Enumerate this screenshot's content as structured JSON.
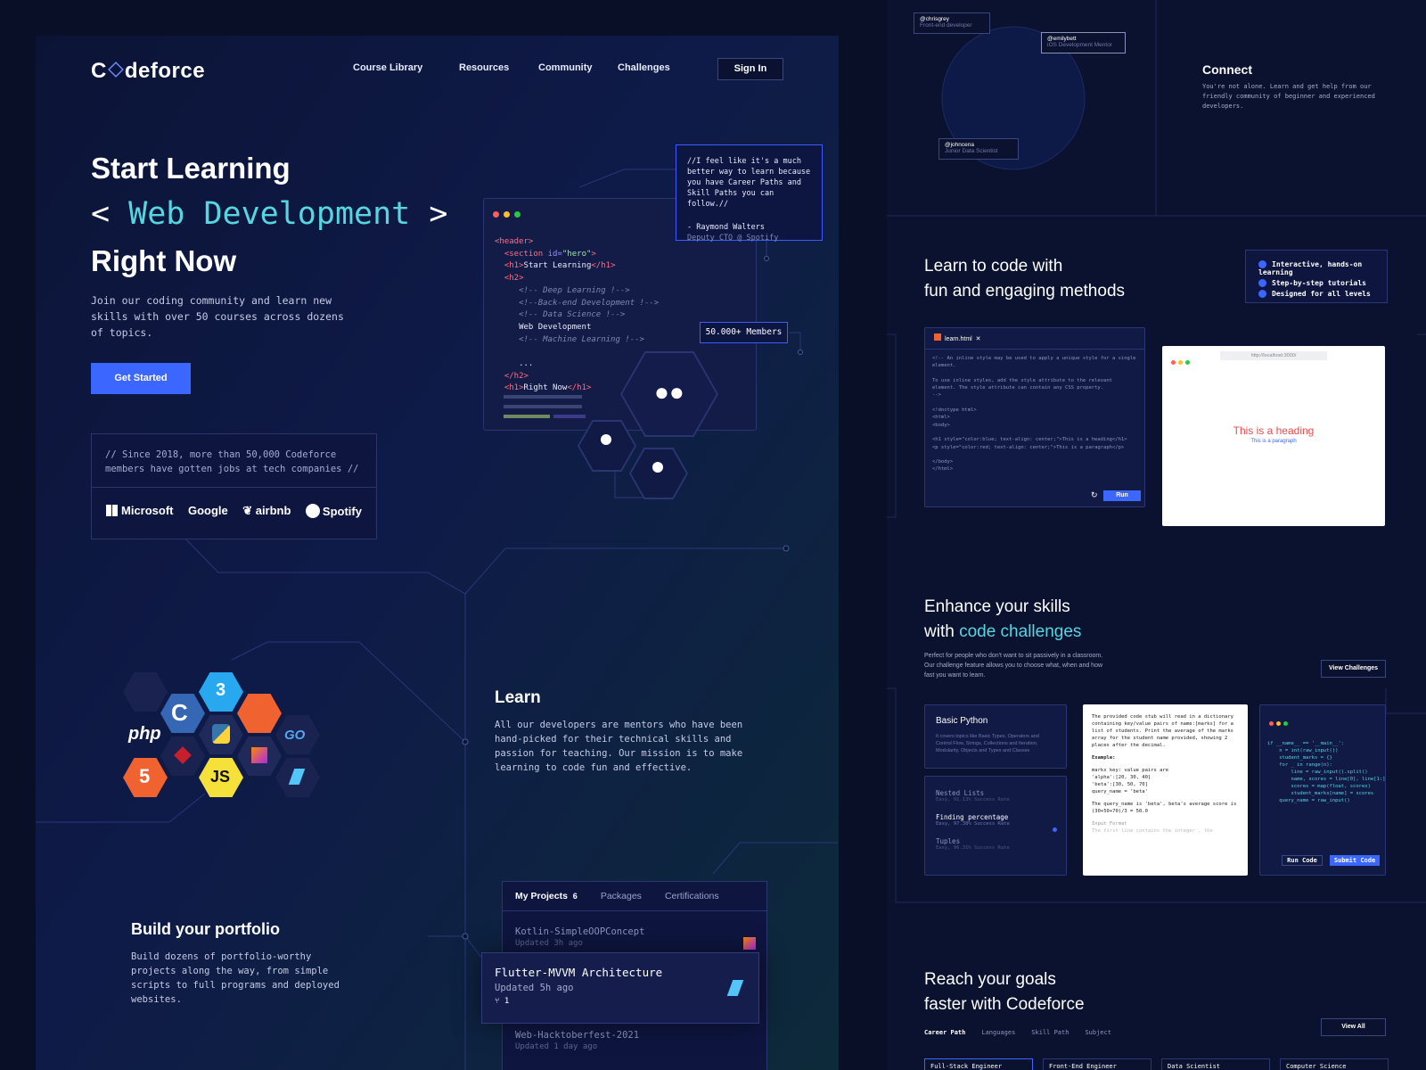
{
  "brand": {
    "name_pre": "C",
    "name_post": "deforce"
  },
  "nav": {
    "items": [
      "Course Library",
      "Resources",
      "Community",
      "Challenges"
    ],
    "signin": "Sign In"
  },
  "hero": {
    "line1": "Start Learning",
    "open": "<",
    "topic": "Web Development",
    "close": ">",
    "line3": "Right Now",
    "para": "Join our coding community and learn new skills with over 50 courses across dozens of topics.",
    "cta": "Get Started"
  },
  "since": {
    "text": "// Since 2018, more than 50,000 Codeforce members have gotten jobs at tech companies //",
    "companies": [
      "Microsoft",
      "Google",
      "airbnb",
      "Spotify"
    ]
  },
  "code": {
    "l1": "<header>",
    "l2a": "<section ",
    "l2b": "id=",
    "l2c": "\"hero\"",
    "l2d": ">",
    "l3a": "<h1>",
    "l3b": "Start Learning",
    "l3c": "</h1>",
    "l4": "<h2>",
    "c1": "<!-- Deep Learning !-->",
    "c2": "<!--Back-end Development !-->",
    "c3": "<!-- Data Science !-->",
    "l8": "Web Development",
    "c4": "<!-- Machine Learning !-->",
    "l10": "...",
    "l11": "</h2>",
    "l12a": "<h1>",
    "l12b": "Right Now",
    "l12c": "</h1>"
  },
  "quote": {
    "text": "//I feel like it's a much better way to learn because you have Career Paths and Skill Paths you can follow.//",
    "author": "- Raymond Walters",
    "role": "Deputy CTO @ Spotify"
  },
  "members": "50.000+ Members",
  "langs": {
    "php": "php",
    "go": "GO",
    "js": "JS",
    "html": "5",
    "css": "3"
  },
  "learn": {
    "title": "Learn",
    "text": "All our developers are mentors who have been hand-picked for their technical skills and passion for teaching. Our mission is to make learning to code fun and effective."
  },
  "portfolio": {
    "title": "Build your portfolio",
    "text": "Build dozens of portfolio-worthy projects along the way, from simple scripts to full programs and deployed websites."
  },
  "projects": {
    "tabs": [
      "My Projects",
      "Packages",
      "Certifications"
    ],
    "count": "6",
    "items": [
      {
        "name": "Kotlin-SimpleOOPConcept",
        "time": "Updated 3h ago"
      },
      {
        "name": "Web-Hacktoberfest-2021",
        "time": "Updated 1 day ago"
      }
    ],
    "featured": {
      "name": "Flutter-MVVM Architecture",
      "time": "Updated 5h ago",
      "forks": "1"
    }
  },
  "connect": {
    "title": "Connect",
    "text": "You're not alone. Learn and get help from our friendly community of beginner and experienced developers.",
    "users": [
      {
        "handle": "@chrisgrey",
        "role": "Front-end developer"
      },
      {
        "handle": "@emilybett",
        "role": "iOS Development Mentor"
      },
      {
        "handle": "@johncena",
        "role": "Junior Data Scientist"
      }
    ]
  },
  "methods": {
    "title1": "Learn to code with",
    "title2": "fun and engaging methods",
    "checks": [
      "Interactive, hands-on learning",
      "Step-by-step tutorials",
      "Designed for all levels"
    ],
    "file": "learn.html",
    "url": "http://localhost:3000/",
    "run": "Run",
    "heading": "This is a heading",
    "paragraph": "This is a paragraph",
    "editor": [
      "<!-- An inline style may be used to apply a unique style for a single element.",
      "",
      "To use inline styles, add the style attribute to the relevant element. The style attribute can contain any CSS property.",
      "-->",
      "",
      "<!doctype html>",
      "<html>",
      "<body>",
      "",
      "<h1 style=\"color:blue; text-align: center;\">This is a heading</h1>",
      "<p style=\"color:red; text-align: center;\">This is a paragraph</p>",
      "",
      "</body>",
      "</html>"
    ]
  },
  "challenges": {
    "title1": "Enhance your skills",
    "title2a": "with ",
    "title2b": "code challenges",
    "text": "Perfect for people who don't want to sit passively in a classroom. Our challenge feature allows you to choose what, when and how fast you want to learn.",
    "view": "View Challenges",
    "course": "Basic Python",
    "course_desc": "It covers topics like Basic Types, Operators and Control Flow, Strings, Collections and Iteration, Modularity, Objects and Types and Classes",
    "list": [
      {
        "name": "Nested Lists",
        "rate": "Easy, 91.13% Success Rate"
      },
      {
        "name": "Finding percentage",
        "rate": "Easy, 97.38% Success Rate"
      },
      {
        "name": "Tuples",
        "rate": "Easy, 96.31% Success Rate"
      }
    ],
    "problem": "The provided code stub will read in a dictionary containing key/value pairs of name:[marks] for a list of students. Print the average of the marks array for the student name provided, showing 2 places after the decimal.",
    "example_label": "Example:",
    "example": [
      "marks key: value pairs are",
      "'alpha':[20, 30, 40]",
      "'beta':[30, 50, 70]",
      "query_name = 'beta'"
    ],
    "explain": "The query_name is 'beta', beta's average score is (30+50+70)/3 = 50.0",
    "input": "Input Format",
    "input_text": "The first line contains the integer , the",
    "py": [
      "if __name__ == '__main__':",
      "    n = int(raw_input())",
      "    student_marks = {}",
      "    for _ in range(n):",
      "        line = raw_input().split()",
      "        name, scores = line[0], line[1:]",
      "        scores = map(float, scores)",
      "        student_marks[name] = scores",
      "    query_name = raw_input()"
    ],
    "run": "Run Code",
    "submit": "Submit Code"
  },
  "goals": {
    "title1": "Reach your goals",
    "title2": "faster with Codeforce",
    "view": "View All",
    "tabs": [
      "Career Path",
      "Languages",
      "Skill Path",
      "Subject"
    ],
    "cards": [
      "Full-Stack Engineer",
      "Front-End Engineer",
      "Data Scientist",
      "Computer Science"
    ]
  }
}
